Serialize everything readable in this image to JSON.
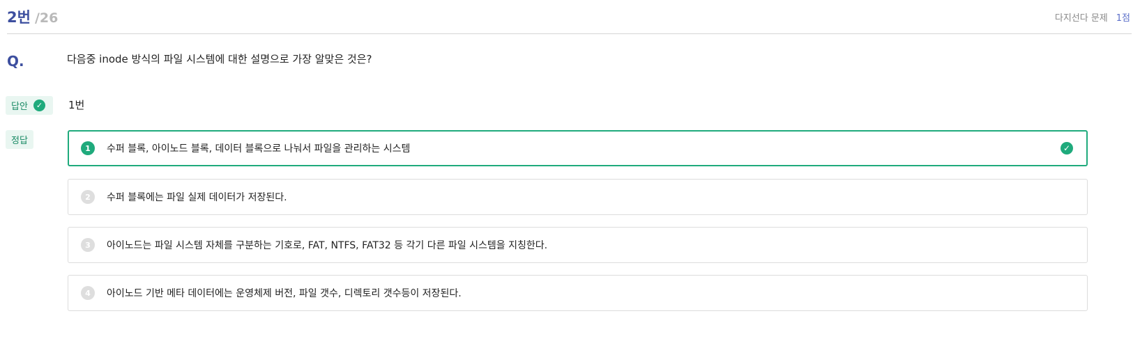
{
  "header": {
    "current": "2번",
    "total": "/26",
    "type": "다지선다 문제",
    "points": "1점"
  },
  "question": {
    "label": "Q.",
    "text": "다음중 inode 방식의 파일 시스템에 대한 설명으로 가장 알맞은 것은?"
  },
  "answer": {
    "tag": "답안",
    "value": "1번"
  },
  "solution": {
    "tag": "정답"
  },
  "choices": [
    {
      "num": "1",
      "text": "수퍼 블록, 아이노드 블록, 데이터 블록으로 나눠서 파일을 관리하는 시스템",
      "correct": true
    },
    {
      "num": "2",
      "text": "수퍼 블록에는 파일 실제 데이터가 저장된다.",
      "correct": false
    },
    {
      "num": "3",
      "text": "아이노드는 파일 시스템 자체를 구분하는 기호로, FAT, NTFS, FAT32 등 각기 다른 파일 시스템을 지칭한다.",
      "correct": false
    },
    {
      "num": "4",
      "text": "아이노드 기반 메타 데이터에는 운영체제 버전, 파일 갯수, 디렉토리 갯수등이 저장된다.",
      "correct": false
    }
  ],
  "colors": {
    "accent": "#1faa7c",
    "title": "#3d4f9f",
    "points": "#5b6fc9"
  },
  "icons": {
    "check": "check-circle-icon"
  }
}
